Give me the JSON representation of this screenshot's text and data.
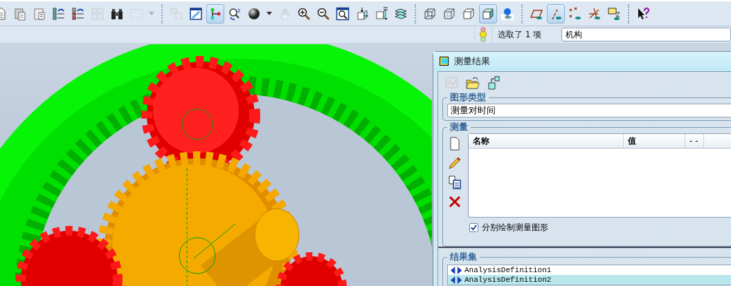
{
  "toolbar": [
    {
      "kind": "page",
      "selected": false,
      "disabled": false
    },
    {
      "kind": "clipboard",
      "selected": false,
      "disabled": false
    },
    {
      "kind": "paste",
      "selected": false,
      "disabled": false
    },
    {
      "kind": "reorder",
      "selected": false,
      "disabled": false
    },
    {
      "kind": "reorder-red",
      "selected": false,
      "disabled": false
    },
    {
      "kind": "grid",
      "selected": false,
      "disabled": true
    },
    {
      "kind": "binoculars",
      "selected": false,
      "disabled": false
    },
    {
      "kind": "select-box",
      "selected": false,
      "disabled": true
    },
    {
      "kind": "caret",
      "selected": false,
      "disabled": true
    },
    {
      "kind": "separator"
    },
    {
      "kind": "stack",
      "selected": false,
      "disabled": true
    },
    {
      "kind": "display",
      "selected": false,
      "disabled": false
    },
    {
      "kind": "mechanism",
      "selected": true,
      "disabled": false
    },
    {
      "kind": "regen",
      "selected": false,
      "disabled": false
    },
    {
      "kind": "sphere",
      "selected": false,
      "disabled": false
    },
    {
      "kind": "caret",
      "selected": false,
      "disabled": false
    },
    {
      "kind": "hand",
      "selected": false,
      "disabled": true
    },
    {
      "kind": "zoom-in",
      "selected": false,
      "disabled": false
    },
    {
      "kind": "zoom-out",
      "selected": false,
      "disabled": false
    },
    {
      "kind": "zoom-fit",
      "selected": false,
      "disabled": false
    },
    {
      "kind": "orient",
      "selected": false,
      "disabled": false
    },
    {
      "kind": "views",
      "selected": false,
      "disabled": false
    },
    {
      "kind": "layers",
      "selected": false,
      "disabled": false
    },
    {
      "kind": "separator"
    },
    {
      "kind": "wireframe",
      "selected": false,
      "disabled": false
    },
    {
      "kind": "hidden-line",
      "selected": false,
      "disabled": false
    },
    {
      "kind": "no-hidden",
      "selected": false,
      "disabled": false
    },
    {
      "kind": "shaded",
      "selected": true,
      "disabled": false
    },
    {
      "kind": "pin",
      "selected": false,
      "disabled": false
    },
    {
      "kind": "separator"
    },
    {
      "kind": "plane",
      "selected": false,
      "disabled": false
    },
    {
      "kind": "axis",
      "selected": true,
      "disabled": false
    },
    {
      "kind": "points",
      "selected": false,
      "disabled": false
    },
    {
      "kind": "csys",
      "selected": false,
      "disabled": false
    },
    {
      "kind": "note",
      "selected": false,
      "disabled": false
    },
    {
      "kind": "separator"
    },
    {
      "kind": "help",
      "selected": false,
      "disabled": false
    }
  ],
  "status": {
    "message": "选取了 1 项",
    "filter": "机构"
  },
  "dialog": {
    "title": "测量结果",
    "toolbar": [
      {
        "kind": "graph",
        "disabled": true
      },
      {
        "kind": "open",
        "disabled": false
      },
      {
        "kind": "export",
        "disabled": false
      }
    ],
    "graph_type": {
      "label": "图形类型",
      "value": "测量对时间"
    },
    "measures": {
      "label": "测量",
      "tools": [
        {
          "kind": "new"
        },
        {
          "kind": "edit"
        },
        {
          "kind": "copy"
        },
        {
          "kind": "delete"
        }
      ],
      "columns": [
        "名称",
        "值",
        "- -"
      ],
      "plot_separately": {
        "label": "分别绘制测量图形",
        "checked": true
      }
    },
    "result_sets": {
      "label": "结果集",
      "items": [
        {
          "name": "AnalysisDefinition1",
          "selected": false
        },
        {
          "name": "AnalysisDefinition2",
          "selected": true
        }
      ]
    }
  }
}
